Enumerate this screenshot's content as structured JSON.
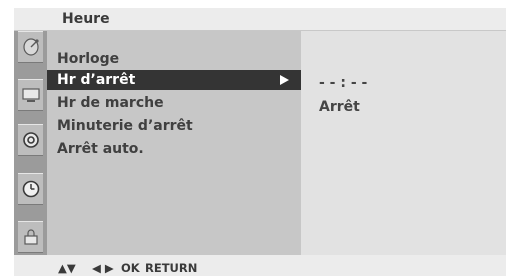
{
  "header": {
    "title": "Heure"
  },
  "sidebar": {
    "icons": [
      {
        "name": "satellite-dish-icon"
      },
      {
        "name": "tv-screen-icon"
      },
      {
        "name": "speaker-icon"
      },
      {
        "name": "clock-icon",
        "active": true
      },
      {
        "name": "lock-icon"
      }
    ]
  },
  "menu": {
    "items": [
      {
        "label": "Horloge"
      },
      {
        "label": "Hr d’arrêt",
        "selected": true
      },
      {
        "label": "Hr de marche"
      },
      {
        "label": "Minuterie d’arrêt"
      },
      {
        "label": "Arrêt auto."
      }
    ]
  },
  "submenu": {
    "time_value": "- - : - -",
    "state_value": "Arrêt"
  },
  "footer": {
    "nav_updown": "▲▼",
    "nav_leftright": "◀ ▶",
    "ok_label": "OK",
    "return_label": "RETURN"
  },
  "colors": {
    "selected_bg": "#343434",
    "menu_bg": "#c7c7c7",
    "submenu_bg": "#e2e2e2",
    "icon_bar_bg": "#9b9b9b"
  }
}
